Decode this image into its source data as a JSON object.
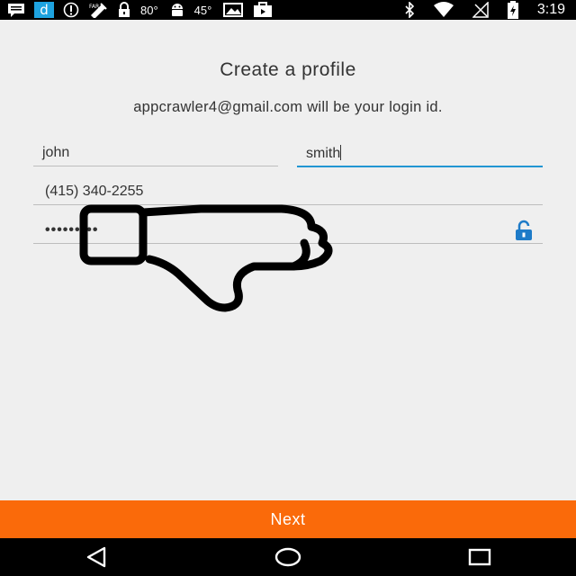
{
  "status_bar": {
    "temp1": "80°",
    "temp2": "45°",
    "time": "3:19",
    "icons": [
      "message-icon",
      "app-d-icon",
      "info-icon",
      "satellite-icon",
      "lock-icon",
      "android-icon",
      "image-icon",
      "briefcase-icon",
      "bluetooth-icon",
      "wifi-icon",
      "signal-icon",
      "battery-icon"
    ]
  },
  "form": {
    "title": "Create a profile",
    "subtitle": "appcrawler4@gmail.com will be your login id.",
    "first_name": "john",
    "last_name": "smith",
    "phone": "(415) 340-2255",
    "password_mask": "•••••••••",
    "lock_icon": "unlock-icon"
  },
  "overlay": {
    "icon": "thumbs-down-icon"
  },
  "actions": {
    "next_label": "Next"
  },
  "nav": {
    "back": "back-icon",
    "home": "home-icon",
    "recents": "recents-icon"
  },
  "colors": {
    "accent": "#2196d3",
    "button": "#fa6a0a",
    "background": "#efefef"
  }
}
